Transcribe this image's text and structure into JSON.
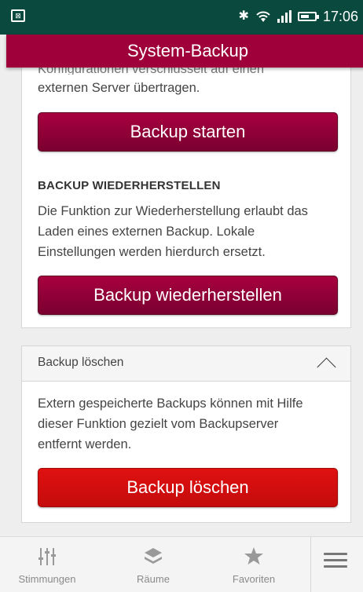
{
  "status_bar": {
    "time": "17:06",
    "colors": {
      "background": "#0a4a3e"
    }
  },
  "header": {
    "title": "System-Backup",
    "color": "#a0003a"
  },
  "backup_card": {
    "partial_text": "Konfigurationen verschlüsselt auf einen",
    "intro_line": "externen Server übertragen.",
    "start_button": "Backup starten",
    "restore_heading": "BACKUP WIEDERHERSTELLEN",
    "restore_text_lines": [
      "Die Funktion zur Wiederherstellung erlaubt das",
      "Laden eines externen Backup. Lokale",
      "Einstellungen werden hierdurch ersetzt."
    ],
    "restore_button": "Backup wiederherstellen"
  },
  "delete_card": {
    "title": "Backup löschen",
    "text_lines": [
      "Extern gespeicherte Backups können mit Hilfe",
      "dieser Funktion gezielt vom Backupserver",
      "entfernt werden."
    ],
    "delete_button": "Backup löschen",
    "button_color": "#d00f0f"
  },
  "bottom_nav": {
    "items": [
      {
        "label": "Stimmungen",
        "icon": "sliders-icon"
      },
      {
        "label": "Räume",
        "icon": "layers-icon"
      },
      {
        "label": "Favoriten",
        "icon": "star-icon"
      }
    ],
    "menu_icon": "hamburger-menu-icon"
  }
}
